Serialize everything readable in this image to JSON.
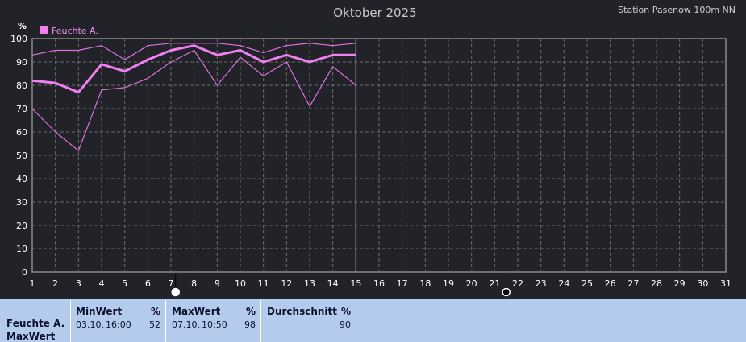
{
  "header": {
    "title": "Oktober 2025",
    "station": "Station Pasenow 100m NN"
  },
  "chart_data": {
    "type": "line",
    "ylabel": "%",
    "ylim": [
      0,
      100
    ],
    "yticks": [
      0,
      10,
      20,
      30,
      40,
      50,
      60,
      70,
      80,
      90,
      100
    ],
    "xlim": [
      1,
      31
    ],
    "x": [
      1,
      2,
      3,
      4,
      5,
      6,
      7,
      8,
      9,
      10,
      11,
      12,
      13,
      14,
      15
    ],
    "series": [
      {
        "name": "Feuchte A.",
        "role": "mean",
        "color": "#f080f0",
        "values": [
          82,
          81,
          77,
          89,
          86,
          91,
          95,
          97,
          93,
          95,
          90,
          93,
          90,
          93,
          93
        ]
      },
      {
        "role": "max",
        "color": "#e070e0",
        "values": [
          93,
          95,
          95,
          97,
          91,
          97,
          98,
          98,
          98,
          97,
          94,
          97,
          98,
          97,
          98
        ]
      },
      {
        "role": "min",
        "color": "#e070e0",
        "values": [
          70,
          60,
          52,
          78,
          79,
          83,
          90,
          95,
          80,
          92,
          84,
          90,
          71,
          88,
          80
        ]
      }
    ],
    "grid": true,
    "legend": "top-left"
  },
  "panel": {
    "row_label_1": "Feuchte A.",
    "row_label_2": "MaxWert",
    "min": {
      "header": "MinWert",
      "unit": "%",
      "date": "03.10.",
      "time": "16:00",
      "value": "52"
    },
    "max": {
      "header": "MaxWert",
      "unit": "%",
      "date": "07.10.",
      "time": "10:50",
      "value": "98"
    },
    "avg": {
      "header": "Durchschnitt",
      "unit": "%",
      "value": "90"
    }
  }
}
